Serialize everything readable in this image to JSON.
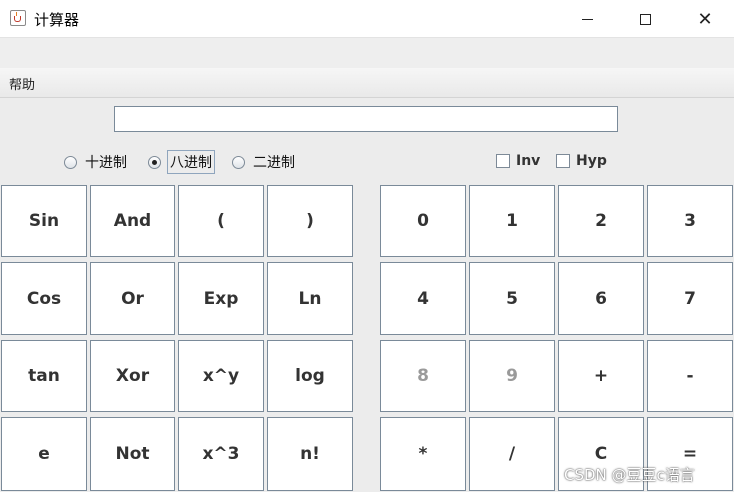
{
  "window": {
    "title": "计算器",
    "close_glyph": "✕"
  },
  "menu": {
    "help": "帮助"
  },
  "display": {
    "value": ""
  },
  "radix": {
    "decimal": "十进制",
    "octal": "八进制",
    "binary": "二进制",
    "selected": "八进制"
  },
  "options": {
    "inv": "Inv",
    "hyp": "Hyp",
    "inv_checked": false,
    "hyp_checked": false
  },
  "function_keys": {
    "sin": "Sin",
    "and": "And",
    "lparen": "(",
    "rparen": ")",
    "cos": "Cos",
    "or": "Or",
    "exp": "Exp",
    "ln": "Ln",
    "tan": "tan",
    "xor": "Xor",
    "pow": "x^y",
    "log": "log",
    "e": "e",
    "not": "Not",
    "cube": "x^3",
    "fact": "n!"
  },
  "digit_keys": {
    "d0": "0",
    "d1": "1",
    "d2": "2",
    "d3": "3",
    "d4": "4",
    "d5": "5",
    "d6": "6",
    "d7": "7",
    "d8": "8",
    "d9": "9",
    "plus": "+",
    "minus": "-",
    "mul": "*",
    "div": "/",
    "clear": "C",
    "equals": "="
  },
  "watermark": "CSDN @豆豆c语言",
  "colors": {
    "button_border": "#7a8a99",
    "disabled_text": "#9a9a9a",
    "background": "#ececec"
  }
}
